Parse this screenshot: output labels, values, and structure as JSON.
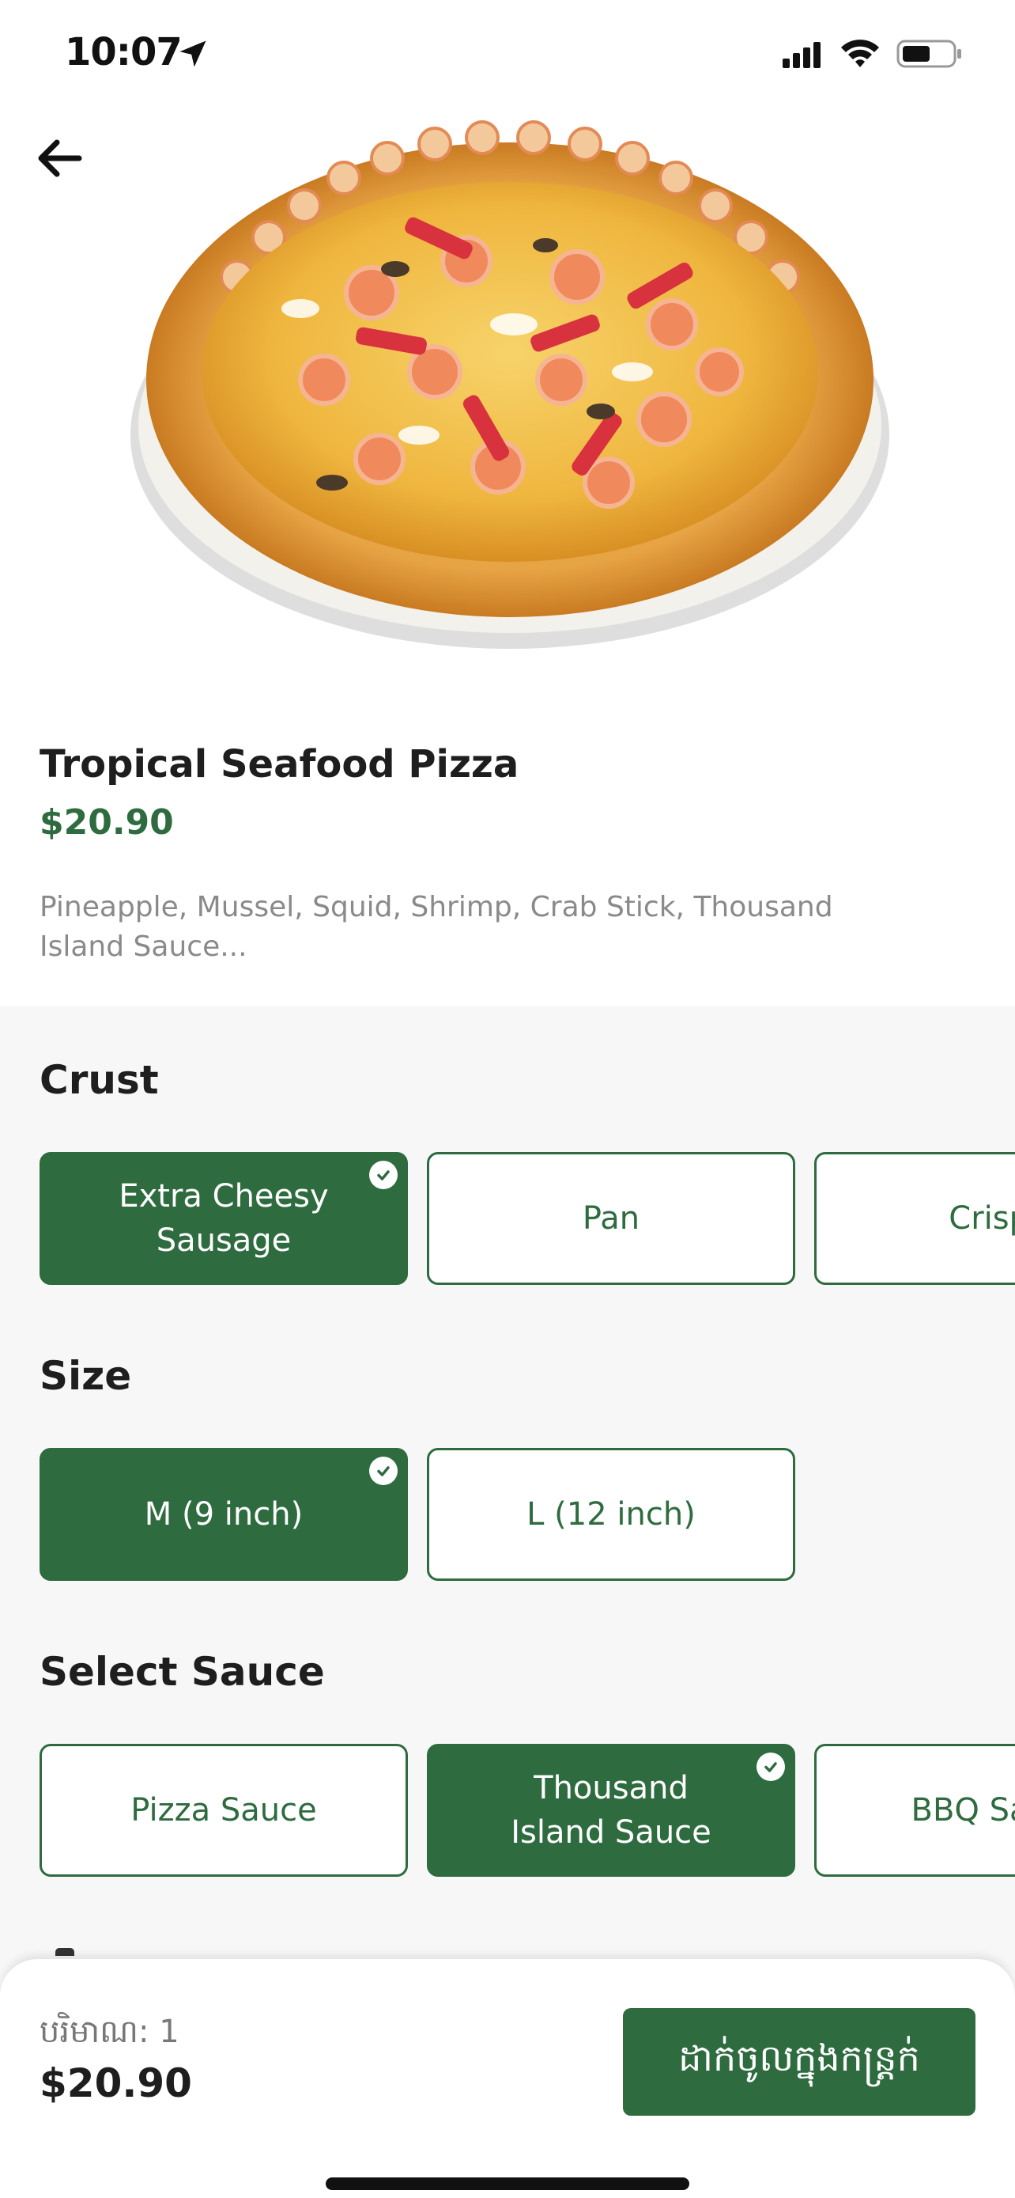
{
  "status_bar": {
    "time": "10:07"
  },
  "product": {
    "title": "Tropical Seafood Pizza",
    "price": "$20.90",
    "description": "Pineapple, Mussel, Squid, Shrimp, Crab Stick, Thousand Island Sauce..."
  },
  "crust": {
    "title": "Crust",
    "options": [
      {
        "label": "Extra Cheesy\nSausage",
        "selected": true
      },
      {
        "label": "Pan",
        "selected": false
      },
      {
        "label": "Crispy",
        "selected": false
      }
    ]
  },
  "size": {
    "title": "Size",
    "options": [
      {
        "label": "M (9 inch)",
        "selected": true
      },
      {
        "label": "L (12 inch)",
        "selected": false
      }
    ]
  },
  "sauce": {
    "title": "Select Sauce",
    "options": [
      {
        "label": "Pizza Sauce",
        "selected": false
      },
      {
        "label": "Thousand\nIsland Sauce",
        "selected": true
      },
      {
        "label": "BBQ Sauce",
        "selected": false
      }
    ]
  },
  "footer": {
    "quantity_label": "បរិមាណ: 1",
    "total": "$20.90",
    "add_to_cart": "ដាក់ចូលក្នុងកន្ត្រក់"
  },
  "colors": {
    "accent": "#2e6b3f",
    "background": "#f7f7f7",
    "muted_text": "#8a8a8a"
  }
}
